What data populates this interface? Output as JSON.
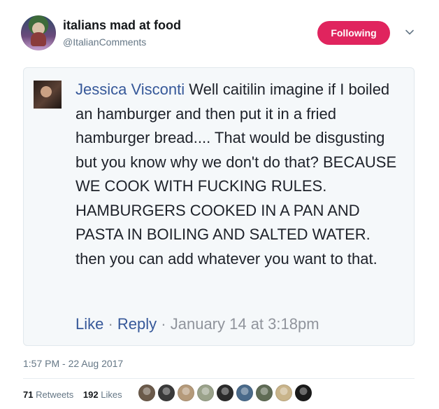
{
  "tweet": {
    "author_name": "italians mad at food",
    "handle": "@ItalianComments",
    "follow_label": "Following",
    "timestamp": "1:57 PM - 22 Aug 2017",
    "retweets_count": "71",
    "retweets_label": "Retweets",
    "likes_count": "192",
    "likes_label": "Likes",
    "likers": [
      {
        "icon": "liker-avatar-1",
        "color": "#6b5a4a"
      },
      {
        "icon": "liker-avatar-2",
        "color": "#3a3a3a"
      },
      {
        "icon": "liker-avatar-3",
        "color": "#b59a7a"
      },
      {
        "icon": "liker-avatar-4",
        "color": "#9aa28a"
      },
      {
        "icon": "liker-avatar-5",
        "color": "#2b2b2b"
      },
      {
        "icon": "liker-avatar-6",
        "color": "#4a6a8a"
      },
      {
        "icon": "liker-avatar-7",
        "color": "#5f6b55"
      },
      {
        "icon": "liker-avatar-8",
        "color": "#c9b48a"
      },
      {
        "icon": "liker-avatar-9",
        "color": "#1a1a1a"
      }
    ]
  },
  "comment": {
    "author": "Jessica Visconti",
    "text": " Well caitilin imagine if I boiled an hamburger and then put it in a fried hamburger bread.... That would be disgusting but you know why we don't do that? BECAUSE WE COOK WITH FUCKING RULES. HAMBURGERS COOKED IN A PAN AND PASTA IN BOILING AND SALTED WATER.",
    "text_2": "then you can add whatever you want to that.",
    "like_label": "Like",
    "sep": " · ",
    "reply_label": "Reply",
    "time": "January 14 at 3:18pm"
  },
  "colors": {
    "follow_button": "#e0245e",
    "comment_link": "#365899",
    "secondary_text": "#657786"
  }
}
